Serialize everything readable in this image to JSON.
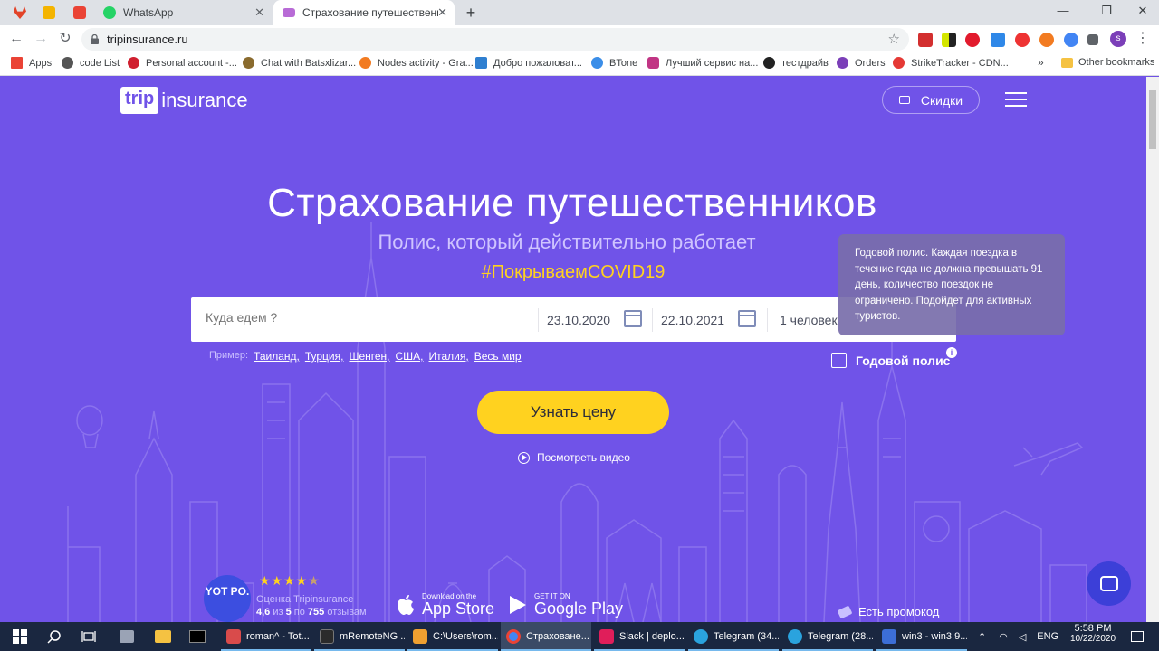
{
  "browser": {
    "tabs": [
      {
        "title": "WhatsApp",
        "favicon_color": "#25d366"
      },
      {
        "title": "Страхование путешественнико",
        "favicon_color": "#b86bd6"
      }
    ],
    "pinned_favicons": [
      "#e24329",
      "#f4b400",
      "#ea4335"
    ],
    "url": "tripinsurance.ru",
    "bookmarks": [
      {
        "label": "Apps",
        "color": "#ea4335"
      },
      {
        "label": "code List",
        "color": "#555555"
      },
      {
        "label": "Personal account -...",
        "color": "#d01f2f"
      },
      {
        "label": "Chat with Batsxlizar...",
        "color": "#8a6b2e"
      },
      {
        "label": "Nodes activity - Gra...",
        "color": "#f27b21"
      },
      {
        "label": "Добро пожаловат...",
        "color": "#2f7fd0"
      },
      {
        "label": "BTone",
        "color": "#3b8ee8"
      },
      {
        "label": "Лучший сервис на...",
        "color": "#c13584"
      },
      {
        "label": "тестдрайв",
        "color": "#222222"
      },
      {
        "label": "Orders",
        "color": "#7b3fb8"
      },
      {
        "label": "StrikeTracker - CDN...",
        "color": "#e53935"
      }
    ],
    "bookmarks_overflow": "»",
    "other_bookmarks": "Other bookmarks",
    "profile_initial": "s"
  },
  "site": {
    "logo_box": "trip",
    "logo_text": "insurance",
    "discount_label": "Скидки",
    "hero_title": "Страхование путешественников",
    "hero_subtitle": "Полис, который действительно работает",
    "hero_hashtag": "#ПокрываемCOVID19",
    "search": {
      "destination_placeholder": "Куда едем ?",
      "date_from": "23.10.2020",
      "date_to": "22.10.2021",
      "people": "1 человек"
    },
    "examples_label": "Пример:",
    "examples": [
      "Таиланд,",
      "Турция,",
      "Шенген,",
      "США,",
      "Италия,",
      "Весь мир"
    ],
    "annual_label": "Годовой полис",
    "tooltip": "Годовой полис. Каждая поездка в течение года не должна превышать 91 день, количество поездок не ограничено. Подойдет для активных туристов.",
    "price_button": "Узнать цену",
    "video_link": "Посмотреть видео",
    "yotpo": "YOT PO.",
    "rating_label": "Оценка Tripinsurance",
    "rating_value": "4,6",
    "rating_mid": " из ",
    "rating_max": "5",
    "rating_by": " по ",
    "rating_count": "755",
    "rating_suffix": " отзывам",
    "app_store_small": "Download on the",
    "app_store_big": "App Store",
    "google_play_small": "GET IT ON",
    "google_play_big": "Google Play",
    "promo": "Есть промокод",
    "rating_stars": 4.5
  },
  "taskbar": {
    "apps": [
      {
        "label": "roman^ - Tot...",
        "color": "#d94b4b"
      },
      {
        "label": "mRemoteNG ...",
        "color": "#2b2b2b"
      },
      {
        "label": "C:\\Users\\rom...",
        "color": "#f0a030"
      },
      {
        "label": "Страховане...",
        "color": "#4285f4"
      },
      {
        "label": "Slack | deplo...",
        "color": "#e01e5a"
      },
      {
        "label": "Telegram (34...",
        "color": "#2aa3de"
      },
      {
        "label": "Telegram (28...",
        "color": "#2aa3de"
      },
      {
        "label": "win3 - win3.9...",
        "color": "#3c6ed6"
      }
    ],
    "language": "ENG",
    "time": "5:58 PM",
    "date": "10/22/2020"
  }
}
